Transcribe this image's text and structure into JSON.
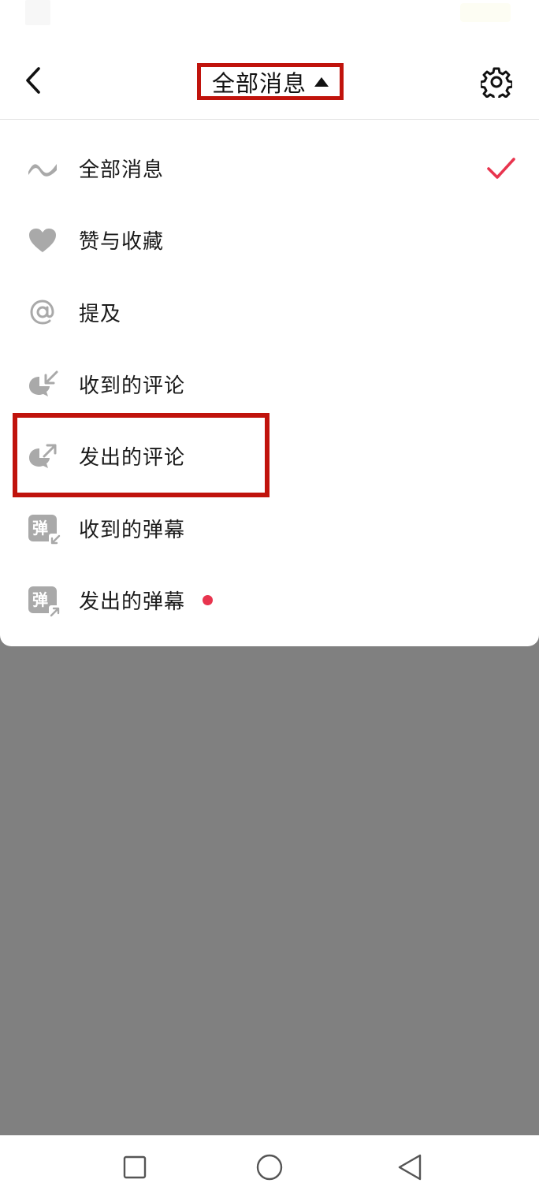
{
  "header": {
    "title": "全部消息"
  },
  "menu": {
    "items": [
      {
        "label": "全部消息",
        "icon": "wave-icon",
        "selected": true
      },
      {
        "label": "赞与收藏",
        "icon": "heart-icon"
      },
      {
        "label": "提及",
        "icon": "at-icon"
      },
      {
        "label": "收到的评论",
        "icon": "comment-received-icon"
      },
      {
        "label": "发出的评论",
        "icon": "comment-sent-icon"
      },
      {
        "label": "收到的弹幕",
        "icon": "danmaku-received-icon",
        "icon_text": "弹"
      },
      {
        "label": "发出的弹幕",
        "icon": "danmaku-sent-icon",
        "icon_text": "弹",
        "badge": "unread-dot"
      }
    ]
  },
  "colors": {
    "accent": "#e8344e",
    "highlight": "#c0130c",
    "icon_gray": "#a9a9a9",
    "overlay": "#808080"
  },
  "navbar": {
    "buttons": [
      "square-icon",
      "circle-icon",
      "triangle-back-icon"
    ]
  }
}
